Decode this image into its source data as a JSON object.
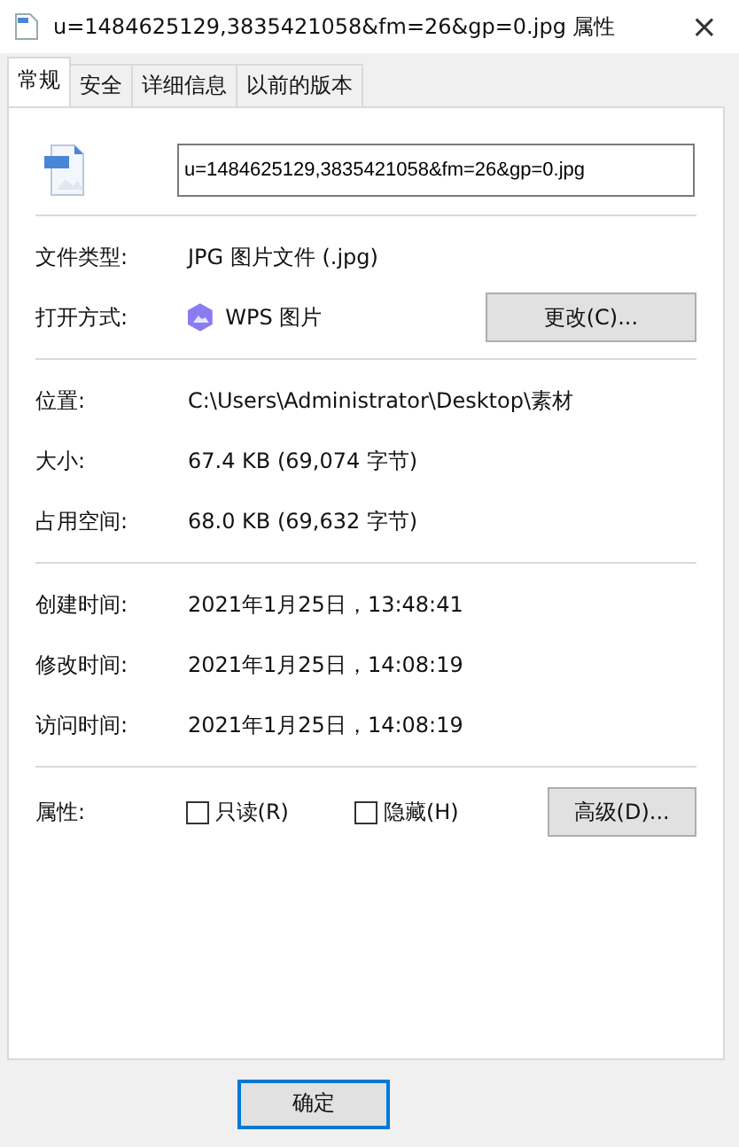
{
  "window": {
    "title": "u=1484625129,3835421058&fm=26&gp=0.jpg 属性",
    "close": "×"
  },
  "tabs": [
    {
      "label": "常规",
      "selected": true
    },
    {
      "label": "安全",
      "selected": false
    },
    {
      "label": "详细信息",
      "selected": false
    },
    {
      "label": "以前的版本",
      "selected": false
    }
  ],
  "file_name": {
    "value": "u=1484625129,3835421058&fm=26&gp=0.jpg"
  },
  "groups": [
    [
      {
        "label": "文件类型:",
        "value": "JPG 图片文件 (.jpg)"
      },
      {
        "label": "打开方式:",
        "value": "WPS 图片",
        "kind": "app",
        "button": "更改(C)..."
      }
    ],
    [
      {
        "label": "位置:",
        "value": "C:\\Users\\Administrator\\Desktop\\素材"
      },
      {
        "label": "大小:",
        "value": "67.4 KB (69,074 字节)"
      },
      {
        "label": "占用空间:",
        "value": "68.0 KB (69,632 字节)"
      }
    ],
    [
      {
        "label": "创建时间:",
        "value": "2021年1月25日，13:48:41"
      },
      {
        "label": "修改时间:",
        "value": "2021年1月25日，14:08:19"
      },
      {
        "label": "访问时间:",
        "value": "2021年1月25日，14:08:19"
      }
    ]
  ],
  "attributes": {
    "label": "属性:",
    "options": [
      {
        "label": "只读(R)",
        "checked": false
      },
      {
        "label": "隐藏(H)",
        "checked": false
      }
    ],
    "button": "高级(D)..."
  },
  "buttons": [
    "确定"
  ]
}
